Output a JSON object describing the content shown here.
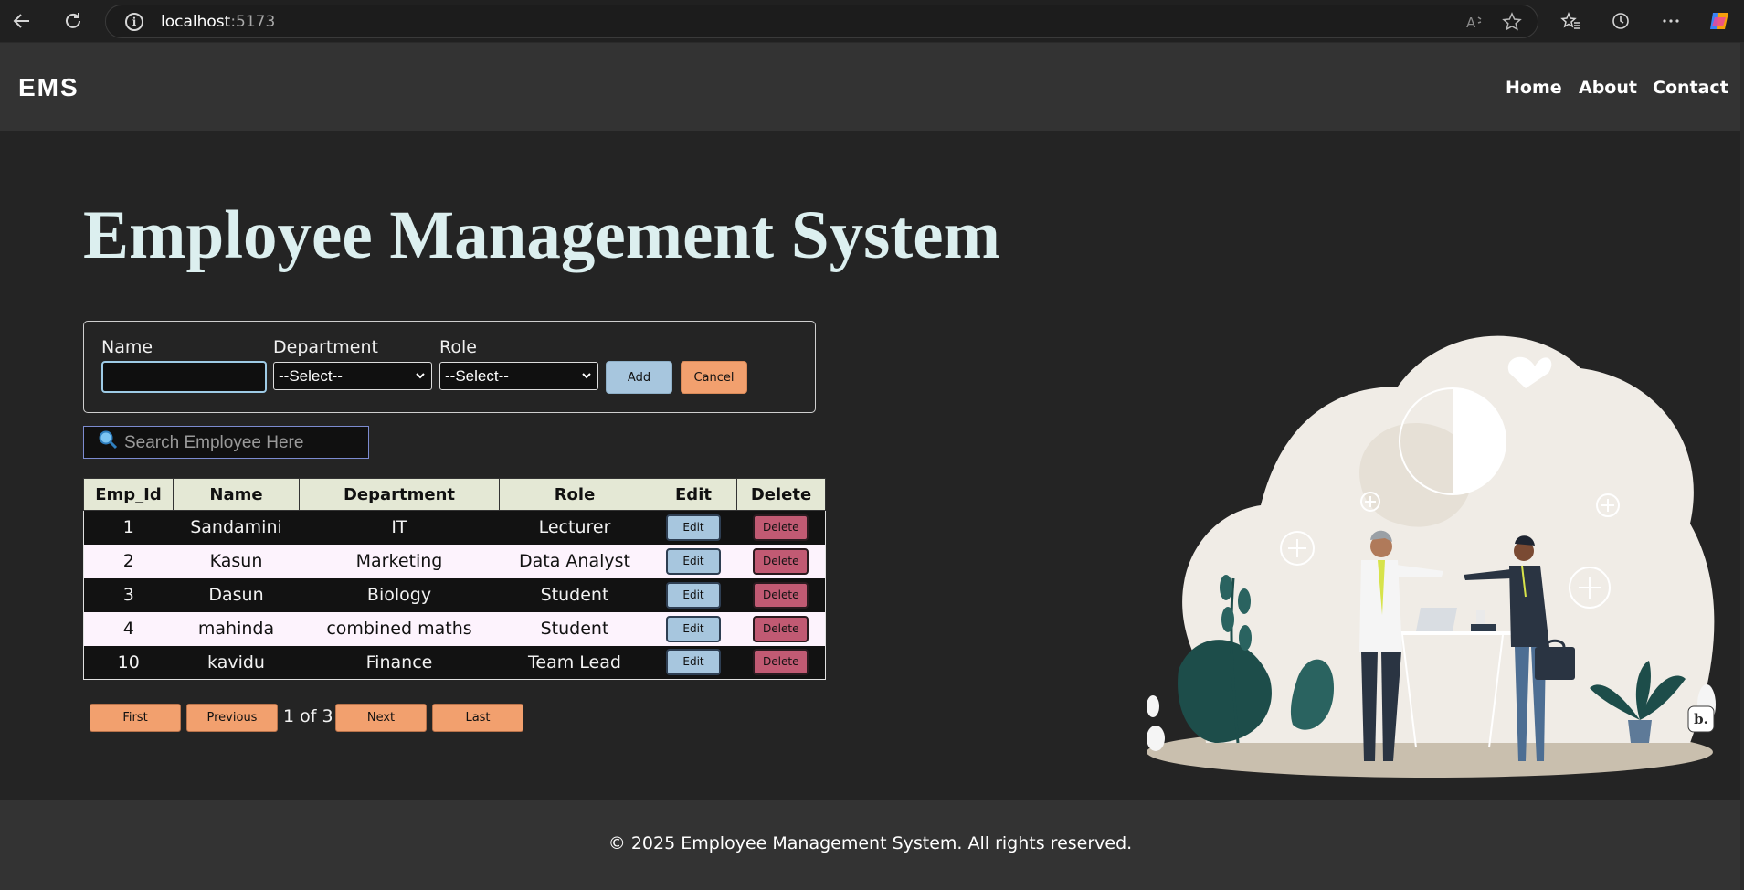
{
  "browser": {
    "url_host": "localhost",
    "url_port": ":5173"
  },
  "navbar": {
    "logo": "EMS",
    "links": [
      "Home",
      "About",
      "Contact"
    ]
  },
  "page": {
    "title": "Employee Management System"
  },
  "form": {
    "name_label": "Name",
    "name_value": "",
    "department_label": "Department",
    "department_selected": "--Select--",
    "role_label": "Role",
    "role_selected": "--Select--",
    "add_label": "Add",
    "cancel_label": "Cancel"
  },
  "search": {
    "placeholder": "Search Employee Here"
  },
  "table": {
    "headers": [
      "Emp_Id",
      "Name",
      "Department",
      "Role",
      "Edit",
      "Delete"
    ],
    "rows": [
      {
        "id": "1",
        "name": "Sandamini",
        "department": "IT",
        "role": "Lecturer",
        "edit": "Edit",
        "delete": "Delete"
      },
      {
        "id": "2",
        "name": "Kasun",
        "department": "Marketing",
        "role": "Data Analyst",
        "edit": "Edit",
        "delete": "Delete"
      },
      {
        "id": "3",
        "name": "Dasun",
        "department": "Biology",
        "role": "Student",
        "edit": "Edit",
        "delete": "Delete"
      },
      {
        "id": "4",
        "name": "mahinda",
        "department": "combined maths",
        "role": "Student",
        "edit": "Edit",
        "delete": "Delete"
      },
      {
        "id": "10",
        "name": "kavidu",
        "department": "Finance",
        "role": "Team Lead",
        "edit": "Edit",
        "delete": "Delete"
      }
    ]
  },
  "pagination": {
    "first": "First",
    "previous": "Previous",
    "info": "1 of 3",
    "next": "Next",
    "last": "Last"
  },
  "footer": {
    "text": "© 2025 Employee Management System. All rights reserved."
  },
  "illustration": {
    "badge": "b."
  },
  "colors": {
    "accent_blue": "#a7c6de",
    "accent_orange": "#f2a06e",
    "delete_red": "#c15a73",
    "title_color": "#dcefef"
  }
}
